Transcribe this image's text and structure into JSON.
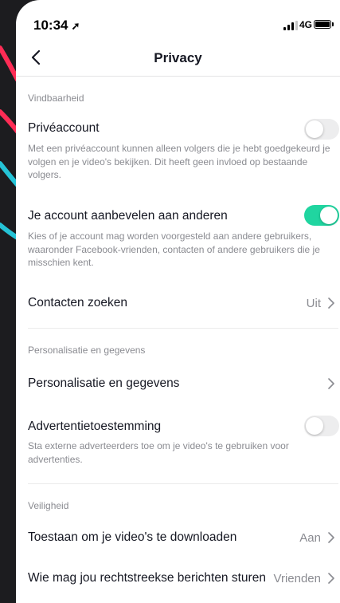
{
  "status_bar": {
    "time": "10:34",
    "network": "4G"
  },
  "nav": {
    "title": "Privacy"
  },
  "sections": {
    "discoverability": "Vindbaarheid",
    "personalization": "Personalisatie en gegevens",
    "safety": "Veiligheid"
  },
  "rows": {
    "private_account": {
      "title": "Privéaccount",
      "description": "Met een privéaccount kunnen alleen volgers die je hebt goedgekeurd je volgen en je video's bekijken. Dit heeft geen invloed op bestaande volgers.",
      "enabled": false
    },
    "suggest_account": {
      "title": "Je account aanbevelen aan anderen",
      "description": "Kies of je account mag worden voorgesteld aan andere gebruikers, waaronder Facebook-vrienden, contacten of andere gebruikers die je misschien kent.",
      "enabled": true
    },
    "find_contacts": {
      "title": "Contacten zoeken",
      "value": "Uit"
    },
    "personalization": {
      "title": "Personalisatie en gegevens"
    },
    "ad_consent": {
      "title": "Advertentietoestemming",
      "description": "Sta externe adverteerders toe om je video's te gebruiken voor advertenties.",
      "enabled": false
    },
    "allow_downloads": {
      "title": "Toestaan om je video's te downloaden",
      "value": "Aan"
    },
    "direct_messages": {
      "title": "Wie mag jou rechtstreekse berichten sturen",
      "value": "Vrienden"
    }
  },
  "colors": {
    "toggle_on": "#20d5a0",
    "toggle_off": "#ededee",
    "secondary_text": "#8a8b91",
    "deco_pink": "#fe2c55",
    "deco_cyan": "#25c3d6"
  }
}
